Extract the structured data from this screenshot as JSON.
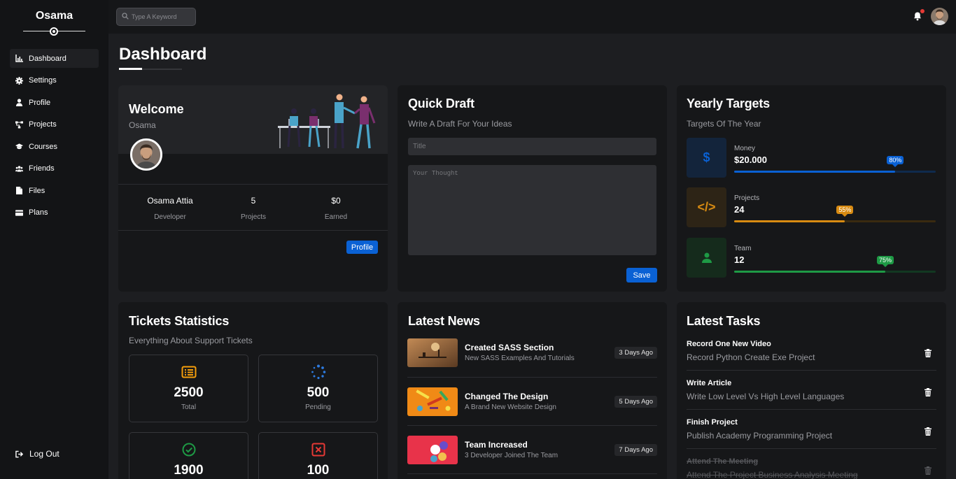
{
  "sidebar": {
    "brand": "Osama",
    "items": [
      {
        "label": "Dashboard",
        "icon": "chart-icon"
      },
      {
        "label": "Settings",
        "icon": "gear-icon"
      },
      {
        "label": "Profile",
        "icon": "user-icon"
      },
      {
        "label": "Projects",
        "icon": "diagram-icon"
      },
      {
        "label": "Courses",
        "icon": "graduation-cap-icon"
      },
      {
        "label": "Friends",
        "icon": "users-icon"
      },
      {
        "label": "Files",
        "icon": "file-icon"
      },
      {
        "label": "Plans",
        "icon": "credit-card-icon"
      }
    ],
    "logout": "Log Out"
  },
  "header": {
    "search_placeholder": "Type A Keyword"
  },
  "page": {
    "title": "Dashboard"
  },
  "welcome": {
    "title": "Welcome",
    "user": "Osama",
    "stats": [
      {
        "value": "Osama Attia",
        "label": "Developer"
      },
      {
        "value": "5",
        "label": "Projects"
      },
      {
        "value": "$0",
        "label": "Earned"
      }
    ],
    "button": "Profile"
  },
  "draft": {
    "title": "Quick Draft",
    "subtitle": "Write A Draft For Your Ideas",
    "title_placeholder": "Title",
    "body_placeholder": "Your Thought",
    "button": "Save"
  },
  "targets": {
    "title": "Yearly Targets",
    "subtitle": "Targets Of The Year",
    "items": [
      {
        "label": "Money",
        "value": "$20.000",
        "percent": 80,
        "badge": "80%",
        "color": "#0a61d4",
        "track": "#0f2a4d",
        "bg": "#13243b",
        "icon": "dollar-icon",
        "glyph": "$"
      },
      {
        "label": "Projects",
        "value": "24",
        "percent": 55,
        "badge": "55%",
        "color": "#d88b12",
        "track": "#3a2a10",
        "bg": "#2d2416",
        "icon": "code-icon",
        "glyph": "</>"
      },
      {
        "label": "Team",
        "value": "12",
        "percent": 75,
        "badge": "75%",
        "color": "#1e9a45",
        "track": "#123821",
        "bg": "#152b1c",
        "icon": "user-icon",
        "glyph": ""
      }
    ]
  },
  "tickets": {
    "title": "Tickets Statistics",
    "subtitle": "Everything About Support Tickets",
    "items": [
      {
        "value": "2500",
        "label": "Total",
        "icon": "list-icon",
        "color": "#f59e0b"
      },
      {
        "value": "500",
        "label": "Pending",
        "icon": "spinner-icon",
        "color": "#2d7be0"
      },
      {
        "value": "1900",
        "label": "",
        "icon": "check-circle-icon",
        "color": "#1e9a45"
      },
      {
        "value": "100",
        "label": "",
        "icon": "close-square-icon",
        "color": "#e53935"
      }
    ]
  },
  "news": {
    "title": "Latest News",
    "items": [
      {
        "title": "Created SASS Section",
        "desc": "New SASS Examples And Tutorials",
        "badge": "3 Days Ago"
      },
      {
        "title": "Changed The Design",
        "desc": "A Brand New Website Design",
        "badge": "5 Days Ago"
      },
      {
        "title": "Team Increased",
        "desc": "3 Developer Joined The Team",
        "badge": "7 Days Ago"
      }
    ]
  },
  "tasks": {
    "title": "Latest Tasks",
    "items": [
      {
        "title": "Record One New Video",
        "desc": "Record Python Create Exe Project",
        "done": false
      },
      {
        "title": "Write Article",
        "desc": "Write Low Level Vs High Level Languages",
        "done": false
      },
      {
        "title": "Finish Project",
        "desc": "Publish Academy Programming Project",
        "done": false
      },
      {
        "title": "Attend The Meeting",
        "desc": "Attend The Project Business Analysis Meeting",
        "done": true
      }
    ]
  }
}
